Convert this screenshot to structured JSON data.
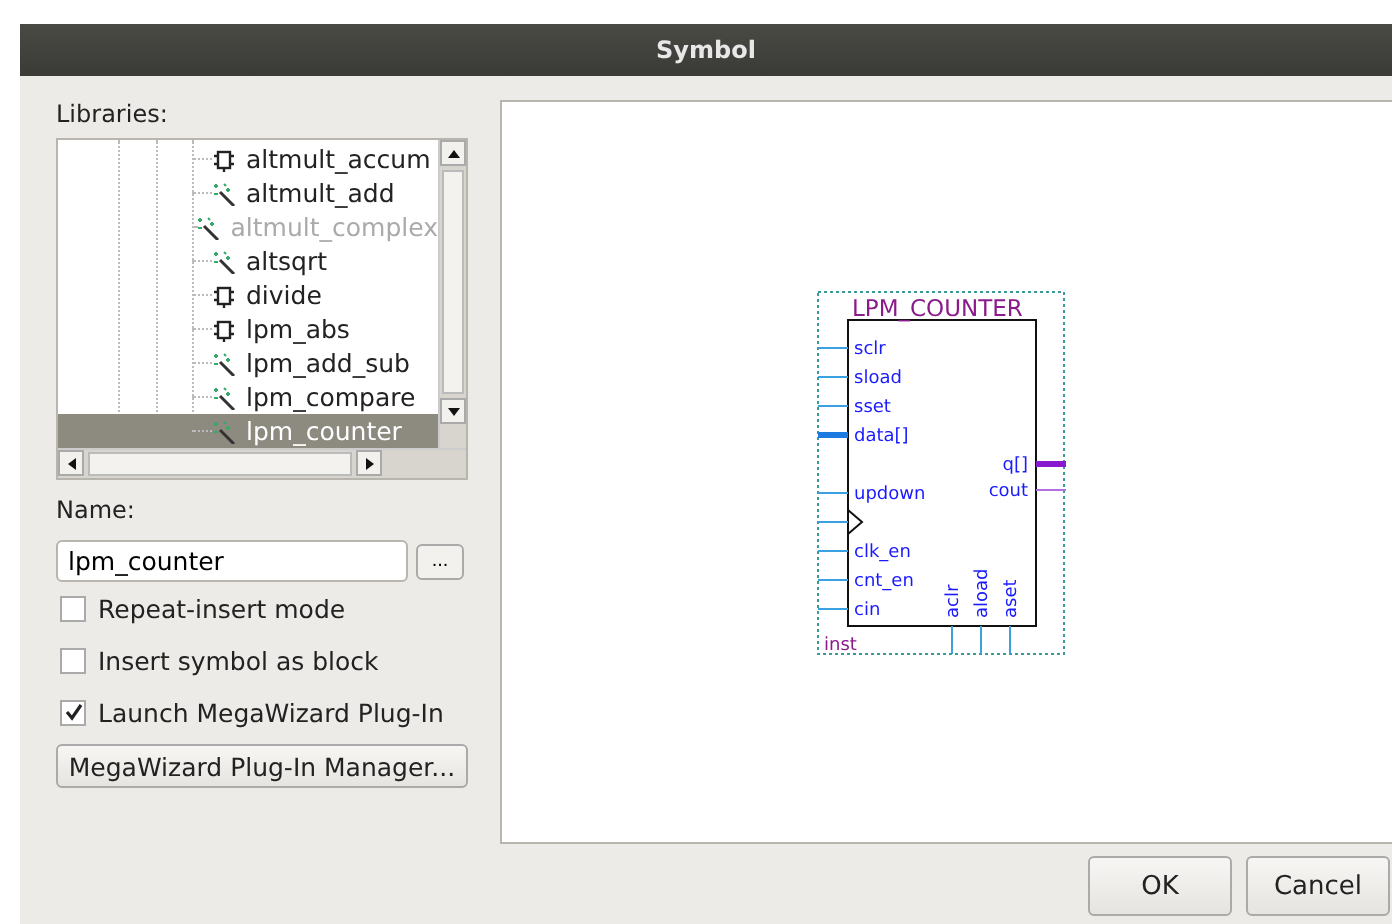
{
  "window": {
    "title": "Symbol"
  },
  "libraries": {
    "label": "Libraries:",
    "items": [
      {
        "name": "altmult_accum",
        "kind": "block",
        "disabled": false,
        "selected": false
      },
      {
        "name": "altmult_add",
        "kind": "wizard",
        "disabled": false,
        "selected": false
      },
      {
        "name": "altmult_complex",
        "kind": "wizard",
        "disabled": true,
        "selected": false
      },
      {
        "name": "altsqrt",
        "kind": "wizard",
        "disabled": false,
        "selected": false
      },
      {
        "name": "divide",
        "kind": "block",
        "disabled": false,
        "selected": false
      },
      {
        "name": "lpm_abs",
        "kind": "block",
        "disabled": false,
        "selected": false
      },
      {
        "name": "lpm_add_sub",
        "kind": "wizard",
        "disabled": false,
        "selected": false
      },
      {
        "name": "lpm_compare",
        "kind": "wizard",
        "disabled": false,
        "selected": false
      },
      {
        "name": "lpm_counter",
        "kind": "wizard",
        "disabled": false,
        "selected": true
      }
    ]
  },
  "name_field": {
    "label": "Name:",
    "value": "lpm_counter",
    "browse": "..."
  },
  "options": [
    {
      "label": "Repeat-insert mode",
      "checked": false
    },
    {
      "label": "Insert symbol as block",
      "checked": false
    },
    {
      "label": "Launch MegaWizard Plug-In",
      "checked": true
    }
  ],
  "manager_button": "MegaWizard Plug-In Manager...",
  "symbol": {
    "title": "LPM_COUNTER",
    "instance": "inst",
    "left_groups": [
      [
        {
          "name": "sclr",
          "bus": false
        },
        {
          "name": "sload",
          "bus": false
        },
        {
          "name": "sset",
          "bus": false
        },
        {
          "name": "data[]",
          "bus": true
        }
      ],
      [
        {
          "name": "updown",
          "bus": false
        },
        {
          "kind": "clock",
          "bus": false
        },
        {
          "name": "clk_en",
          "bus": false
        },
        {
          "name": "cnt_en",
          "bus": false
        },
        {
          "name": "cin",
          "bus": false
        }
      ]
    ],
    "right_pins": [
      {
        "name": "q[]",
        "bus": true
      },
      {
        "name": "cout",
        "bus": false
      }
    ],
    "bottom_pins": [
      {
        "name": "aclr",
        "bus": false
      },
      {
        "name": "aload",
        "bus": false
      },
      {
        "name": "aset",
        "bus": false
      }
    ]
  },
  "buttons": [
    "OK",
    "Cancel"
  ]
}
